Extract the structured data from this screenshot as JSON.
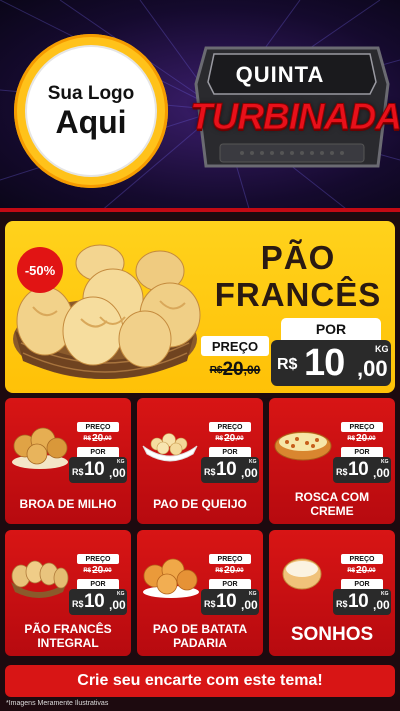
{
  "logo": {
    "line1": "Sua Logo",
    "line2": "Aqui"
  },
  "badge": {
    "top": "QUINTA",
    "main": "TURBINADA"
  },
  "featured": {
    "discount": "-50%",
    "title_line1": "PÃO",
    "title_line2": "FRANCÊS",
    "preco_label": "PREÇO",
    "old_currency": "R$",
    "old_int": "20",
    "old_dec": ",00",
    "por_label": "POR",
    "new_currency": "R$",
    "new_int": "10",
    "new_dec": ",00",
    "unit": "KG"
  },
  "price_common": {
    "preco_label": "PREÇO",
    "por_label": "POR",
    "old_currency": "R$",
    "old_int": "20",
    "old_dec": ",00",
    "new_currency": "R$",
    "new_int": "10",
    "new_dec": ",00",
    "unit": "KG"
  },
  "products": [
    {
      "name": "BROA DE MILHO",
      "icon": "corn-bread-icon"
    },
    {
      "name": "PAO DE QUEIJO",
      "icon": "cheese-bread-icon"
    },
    {
      "name": "ROSCA COM CREME",
      "icon": "cream-bun-icon"
    },
    {
      "name": "PÃO FRANCÊS INTEGRAL",
      "icon": "wholegrain-bread-icon"
    },
    {
      "name": "PAO DE BATATA PADARIA",
      "icon": "potato-bread-icon"
    },
    {
      "name": "SONHOS",
      "icon": "donut-icon"
    }
  ],
  "cta": "Crie seu encarte com este tema!",
  "footnote": "*Imagens Meramente Ilustrativas",
  "colors": {
    "red": "#d81515",
    "yellow": "#ffc107",
    "dark": "#2a2a2a"
  }
}
